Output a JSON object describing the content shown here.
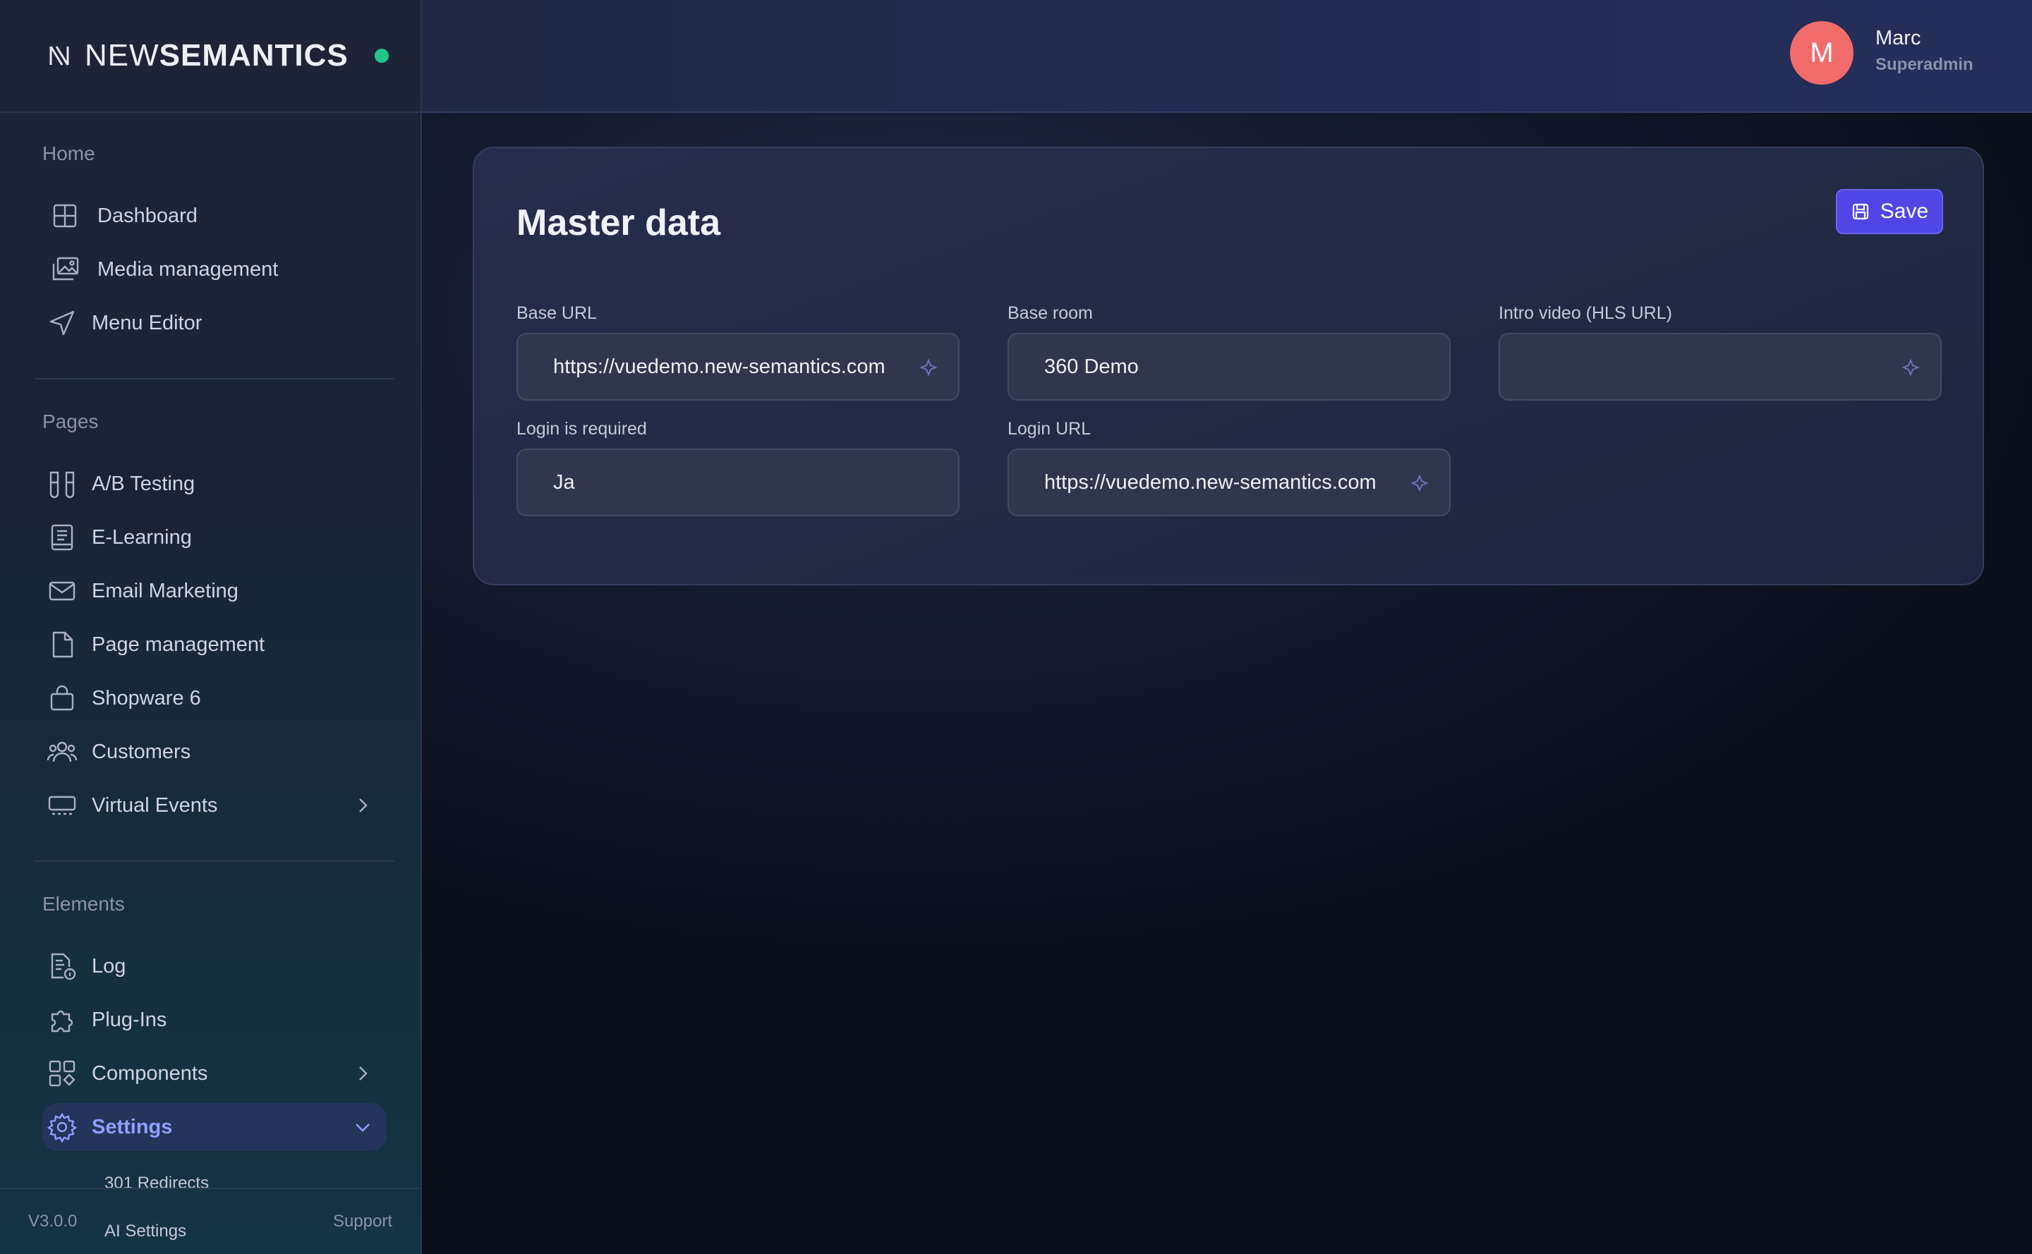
{
  "brand": {
    "name_light": "NEW",
    "name_bold": "SEMANTICS"
  },
  "sidebar": {
    "sections": {
      "home": "Home",
      "pages": "Pages",
      "elements": "Elements"
    },
    "home_items": [
      {
        "label": "Dashboard",
        "icon": "grid-icon"
      },
      {
        "label": "Media management",
        "icon": "images-icon"
      },
      {
        "label": "Menu Editor",
        "icon": "send-icon"
      }
    ],
    "pages_items": [
      {
        "label": "A/B Testing",
        "icon": "test-tubes-icon"
      },
      {
        "label": "E-Learning",
        "icon": "book-icon"
      },
      {
        "label": "Email Marketing",
        "icon": "mail-icon"
      },
      {
        "label": "Page management",
        "icon": "file-icon"
      },
      {
        "label": "Shopware 6",
        "icon": "shopping-bag-icon"
      },
      {
        "label": "Customers",
        "icon": "users-icon"
      },
      {
        "label": "Virtual Events",
        "icon": "tv-icon"
      }
    ],
    "elements_items": [
      {
        "label": "Log",
        "icon": "file-info-icon"
      },
      {
        "label": "Plug-Ins",
        "icon": "puzzle-icon"
      },
      {
        "label": "Components",
        "icon": "components-icon"
      },
      {
        "label": "Settings",
        "icon": "gear-icon"
      }
    ],
    "settings_sub": [
      "301 Redirects",
      "AI Settings"
    ],
    "footer": {
      "version": "V3.0.0",
      "support": "Support"
    }
  },
  "header": {
    "avatar_initial": "M",
    "user_name": "Marc",
    "user_role": "Superadmin"
  },
  "card": {
    "title": "Master data",
    "save_label": "Save",
    "fields": {
      "base_url": {
        "label": "Base URL",
        "value": "https://vuedemo.new-semantics.com"
      },
      "base_room": {
        "label": "Base room",
        "value": "360 Demo"
      },
      "intro_video": {
        "label": "Intro video (HLS URL)",
        "value": ""
      },
      "login_required": {
        "label": "Login is required",
        "value": "Ja"
      },
      "login_url": {
        "label": "Login URL",
        "value": "https://vuedemo.new-semantics.com"
      }
    }
  },
  "colors": {
    "accent": "#4f46e5",
    "active_text": "#8ea0ff",
    "online": "#22c58b",
    "avatar": "#f26b6b"
  }
}
